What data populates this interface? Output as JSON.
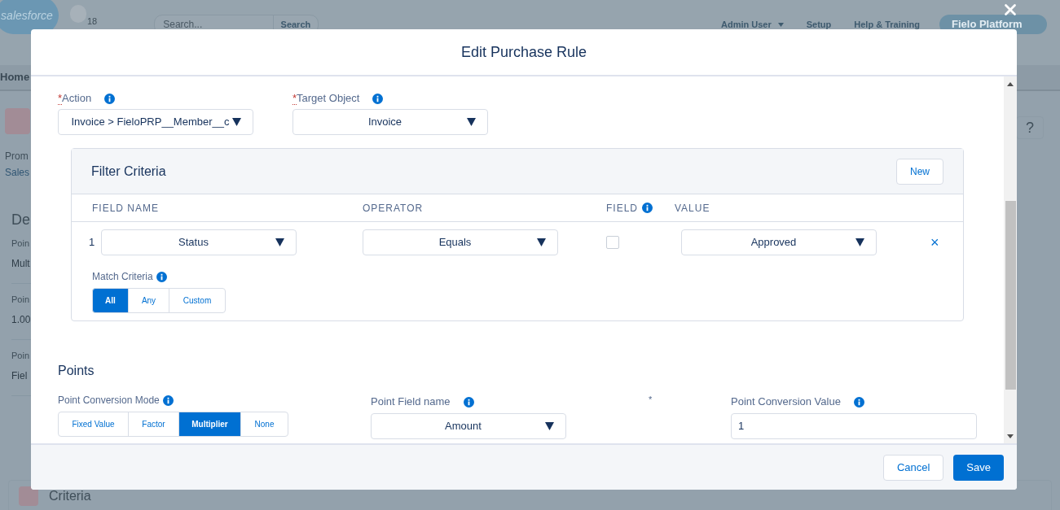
{
  "background": {
    "logo": "salesforce",
    "notification_count": "18",
    "search": {
      "placeholder": "Search...",
      "button": "Search"
    },
    "user_menu": "Admin User",
    "links": [
      "Setup",
      "Help & Training"
    ],
    "app_menu": "Fielo Platform",
    "nav_tab": "Home",
    "record_type": "Prom",
    "record_name": "Sales",
    "section_title": "De",
    "fields": [
      {
        "label": "Poin",
        "value": "Mult"
      },
      {
        "label": "Poin",
        "value": "1.00"
      },
      {
        "label": "Poin",
        "value": "Fiel"
      }
    ],
    "help_button": "?",
    "related_section": "Criteria"
  },
  "modal": {
    "title": "Edit Purchase Rule",
    "action": {
      "required_mark": "*",
      "label": "Action",
      "value": "Invoice > FieloPRP__Member__c"
    },
    "target_object": {
      "required_mark": "*",
      "label": "Target Object",
      "value": "Invoice"
    },
    "filter_criteria": {
      "title": "Filter Criteria",
      "new_button": "New",
      "columns": [
        "FIELD NAME",
        "OPERATOR",
        "FIELD",
        "VALUE"
      ],
      "rows": [
        {
          "number": "1",
          "field_name": "Status",
          "operator": "Equals",
          "field_checked": false,
          "value": "Approved",
          "remove": "×"
        }
      ],
      "match_criteria": {
        "label": "Match Criteria",
        "options": [
          {
            "label": "All",
            "selected": true
          },
          {
            "label": "Any",
            "selected": false
          },
          {
            "label": "Custom",
            "selected": false
          }
        ]
      }
    },
    "points": {
      "title": "Points",
      "conversion_mode": {
        "label": "Point Conversion Mode",
        "options": [
          {
            "label": "Fixed Value",
            "selected": false
          },
          {
            "label": "Factor",
            "selected": false
          },
          {
            "label": "Multiplier",
            "selected": true
          },
          {
            "label": "None",
            "selected": false
          }
        ]
      },
      "field_name": {
        "label": "Point Field name",
        "value": "Amount"
      },
      "required_mark": "*",
      "conversion_value": {
        "label": "Point Conversion Value",
        "value": "1"
      }
    },
    "buttons": {
      "cancel": "Cancel",
      "save": "Save"
    }
  }
}
